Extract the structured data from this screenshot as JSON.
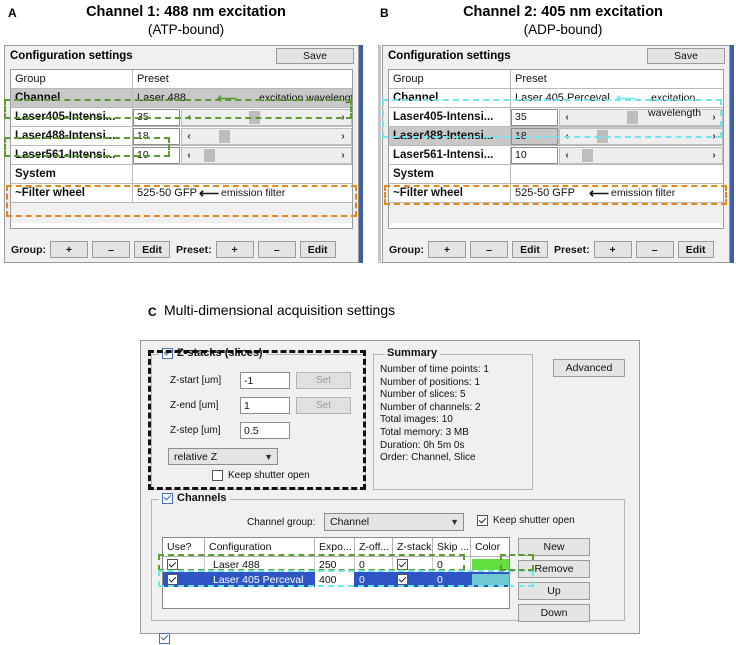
{
  "panels": {
    "a": {
      "letter": "A",
      "title": "Channel 1: 488 nm excitation",
      "subtitle": "(ATP-bound)",
      "window_title": "Configuration settings",
      "save_label": "Save",
      "columns": {
        "group": "Group",
        "preset": "Preset"
      },
      "rows": [
        {
          "group": "Channel",
          "preset": "Laser 488"
        },
        {
          "group": "Laser405-Intensi...",
          "value": "35"
        },
        {
          "group": "Laser488-Intensi...",
          "value": "18"
        },
        {
          "group": "Laser561-Intensi...",
          "value": "10"
        },
        {
          "group": "System",
          "preset": ""
        },
        {
          "group": "~Filter wheel",
          "preset": "525-50 GFP"
        }
      ],
      "annotations": {
        "excitation": "excitation wavelength",
        "emission": "emission filter"
      },
      "footer": {
        "group_label": "Group:",
        "preset_label": "Preset:",
        "plus": "+",
        "minus": "–",
        "edit": "Edit"
      }
    },
    "b": {
      "letter": "B",
      "title": "Channel 2: 405 nm excitation",
      "subtitle": "(ADP-bound)",
      "window_title": "Configuration settings",
      "save_label": "Save",
      "columns": {
        "group": "Group",
        "preset": "Preset"
      },
      "rows": [
        {
          "group": "Channel",
          "preset": "Laser 405 Perceval"
        },
        {
          "group": "Laser405-Intensi...",
          "value": "35"
        },
        {
          "group": "Laser488-Intensi...",
          "value": "18"
        },
        {
          "group": "Laser561-Intensi...",
          "value": "10"
        },
        {
          "group": "System",
          "preset": ""
        },
        {
          "group": "~Filter wheel",
          "preset": "525-50 GFP"
        }
      ],
      "annotations": {
        "excitation_line1": "excitation",
        "excitation_line2": "wavelength",
        "emission": "emission filter"
      },
      "footer": {
        "group_label": "Group:",
        "preset_label": "Preset:",
        "plus": "+",
        "minus": "–",
        "edit": "Edit"
      }
    },
    "c": {
      "letter": "C",
      "title": "Multi-dimensional acquisition settings",
      "zstacks": {
        "legend": "Z-stacks (slices)",
        "fields": [
          {
            "label": "Z-start [um]",
            "value": "-1",
            "button": "Set"
          },
          {
            "label": "Z-end [um]",
            "value": "1",
            "button": "Set"
          },
          {
            "label": "Z-step [um]",
            "value": "0.5"
          }
        ],
        "mode": "relative Z",
        "keep_shutter": "Keep shutter open"
      },
      "summary": {
        "legend": "Summary",
        "lines": [
          "Number of time points: 1",
          "Number of positions: 1",
          "Number of slices: 5",
          "Number of channels: 2",
          "Total images: 10",
          "Total memory: 3 MB",
          "Duration: 0h 5m 0s",
          "Order: Channel, Slice"
        ]
      },
      "advanced_label": "Advanced",
      "channels": {
        "legend": "Channels",
        "group_label": "Channel group:",
        "group_value": "Channel",
        "keep_shutter": "Keep shutter open",
        "headers": [
          "Use?",
          "Configuration",
          "Expo...",
          "Z-off...",
          "Z-stack",
          "Skip ...",
          "Color"
        ],
        "rows": [
          {
            "use": true,
            "configuration": "Laser 488",
            "exposure": "250",
            "zoffset": "0",
            "zstack": true,
            "skip": "0",
            "color": "#63e03f"
          },
          {
            "use": true,
            "configuration": "Laser 405 Perceval",
            "exposure": "400",
            "zoffset": "0",
            "zstack": true,
            "skip": "0",
            "color": "#6fc9d2"
          }
        ],
        "buttons": [
          "New",
          "Remove",
          "Up",
          "Down"
        ]
      }
    }
  },
  "colors": {
    "highlight_green": "#5d9b33",
    "highlight_orange": "#e08a1e",
    "highlight_cyan": "#6fe6ef",
    "selection_blue": "#2f55c4",
    "scrollbar_blue": "#3b5fa8"
  }
}
